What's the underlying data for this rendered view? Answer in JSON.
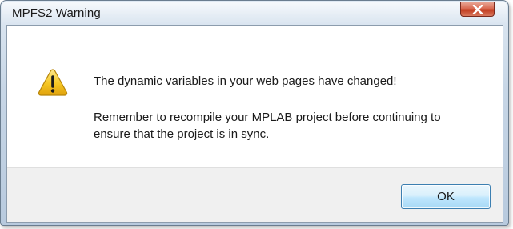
{
  "dialog": {
    "title": "MPFS2 Warning",
    "icon": "warning-icon",
    "message_main": "The dynamic variables in your web pages have changed!",
    "message_detail": "Remember to recompile your MPLAB project before continuing to ensure that the project is in sync.",
    "ok_label": "OK",
    "close_icon": "close-icon"
  },
  "colors": {
    "close_button": "#c94a2f",
    "ok_border": "#3c7fb1",
    "footer_bg": "#f0f0f0",
    "warning_yellow": "#f2c21a"
  }
}
